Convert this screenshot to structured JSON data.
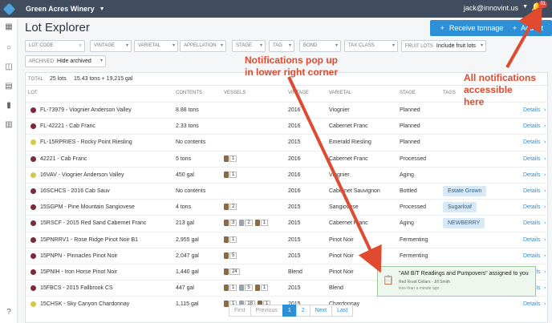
{
  "topbar": {
    "company": "Green Acres Winery",
    "user": "jack@innovint.us",
    "notif_count": "31"
  },
  "page": {
    "title": "Lot Explorer",
    "receive_label": "Receive tonnage",
    "add_label": "Add lot"
  },
  "filters": {
    "lot_code": "LOT CODE",
    "vintage": "VINTAGE",
    "varietal": "VARIETAL",
    "appellation": "APPELLATION",
    "stage": "STAGE",
    "tag": "TAG",
    "bond": "BOND",
    "tax_class": "TAX CLASS",
    "fruit_lots_label": "FRUIT LOTS",
    "fruit_lots_value": "Include fruit lots",
    "archived_label": "ARCHIVED",
    "archived_value": "Hide archived"
  },
  "totals": {
    "label": "TOTAL",
    "lots": "25 lots",
    "volume": "15.43 tons + 19,215 gal"
  },
  "columns": {
    "lot": "LOT",
    "contents": "CONTENTS",
    "vessels": "VESSELS",
    "vintage": "VINTAGE",
    "varietal": "VARIETAL",
    "stage": "STAGE",
    "tags": "TAGS"
  },
  "rows": [
    {
      "name": "FL-73979 - Viognier Anderson Valley",
      "contents": "8.88 tons",
      "vessels": "",
      "vintage": "2016",
      "varietal": "Viognier",
      "stage": "Planned",
      "tag": "",
      "color": "#7a2a3a"
    },
    {
      "name": "FL-42221 - Cab Franc",
      "contents": "2.33 tons",
      "vessels": "",
      "vintage": "2016",
      "varietal": "Cabernet Franc",
      "stage": "Planned",
      "tag": "",
      "color": "#7a2a3a"
    },
    {
      "name": "FL-15RPRIES - Rocky Point Riesling",
      "contents": "No contents",
      "vessels": "",
      "vintage": "2015",
      "varietal": "Emerald Riesling",
      "stage": "Planned",
      "tag": "",
      "color": "#d6c84a"
    },
    {
      "name": "42221 - Cab Franc",
      "contents": "5 tons",
      "vessels": "1",
      "vintage": "2016",
      "varietal": "Cabernet Franc",
      "stage": "Processed",
      "tag": "",
      "color": "#7a2a3a"
    },
    {
      "name": "16VAV - Viognier Anderson Valley",
      "contents": "450 gal",
      "vessels": "1",
      "vintage": "2016",
      "varietal": "Viognier",
      "stage": "Aging",
      "tag": "",
      "color": "#d6c84a"
    },
    {
      "name": "16SCHCS - 2016 Cab Sauv",
      "contents": "No contents",
      "vessels": "",
      "vintage": "2016",
      "varietal": "Cabernet Sauvignon",
      "stage": "Bottled",
      "tag": "Estate Grown",
      "color": "#7a2a3a"
    },
    {
      "name": "15SGPM - Pine Mountain Sangiovese",
      "contents": "4 tons",
      "vessels": "2",
      "vintage": "2015",
      "varietal": "Sangiovese",
      "stage": "Processed",
      "tag": "Sugarloaf",
      "color": "#7a2a3a"
    },
    {
      "name": "15RSCF - 2015 Red Sand Cabernet Franc",
      "contents": "213 gal",
      "vessels": "3  2  1",
      "vintage": "2015",
      "varietal": "Cabernet Franc",
      "stage": "Aging",
      "tag": "NEWBERRY",
      "color": "#7a2a3a"
    },
    {
      "name": "15PNRRV1 - Rose Ridge Pinot Noir B1",
      "contents": "2,955 gal",
      "vessels": "1",
      "vintage": "2015",
      "varietal": "Pinot Noir",
      "stage": "Fermenting",
      "tag": "",
      "color": "#7a2a3a"
    },
    {
      "name": "15PNPN - Pinnacles Pinot Noir",
      "contents": "2,047 gal",
      "vessels": "5",
      "vintage": "2015",
      "varietal": "Pinot Noir",
      "stage": "Fermenting",
      "tag": "",
      "color": "#7a2a3a"
    },
    {
      "name": "15PNIH - Iron Horse Pinot Noir",
      "contents": "1,440 gal",
      "vessels": "24",
      "vintage": "Blend",
      "varietal": "Pinot Noir",
      "stage": "ML",
      "tag": "Estate Grown",
      "color": "#7a2a3a"
    },
    {
      "name": "15FBCS - 2015 Fallbrook CS",
      "contents": "447 gal",
      "vessels": "1  5  1",
      "vintage": "2015",
      "varietal": "Blend",
      "stage": "",
      "tag": "",
      "color": "#7a2a3a"
    },
    {
      "name": "15CHSK - Sky Canyon Chardonnay",
      "contents": "1,115 gal",
      "vessels": "1  18  1",
      "vintage": "2015",
      "varietal": "Chardonnay",
      "stage": "",
      "tag": "",
      "color": "#d6c84a"
    }
  ],
  "details_label": "Details",
  "pager": {
    "first": "First",
    "previous": "Previous",
    "p1": "1",
    "p2": "2",
    "next": "Next",
    "last": "Last"
  },
  "toast": {
    "message": "\"AM B/T Readings and Pumpovers\" assigned to you",
    "sub": "Red Road Cellars - Jill Smith",
    "time": "less than a minute ago"
  },
  "annotations": {
    "popup": "Notifications pop up\nin lower right corner",
    "all": "All notifications\naccessible\nhere"
  },
  "colors": {
    "accent": "#2d8fd6",
    "annotation": "#e04a2f"
  }
}
